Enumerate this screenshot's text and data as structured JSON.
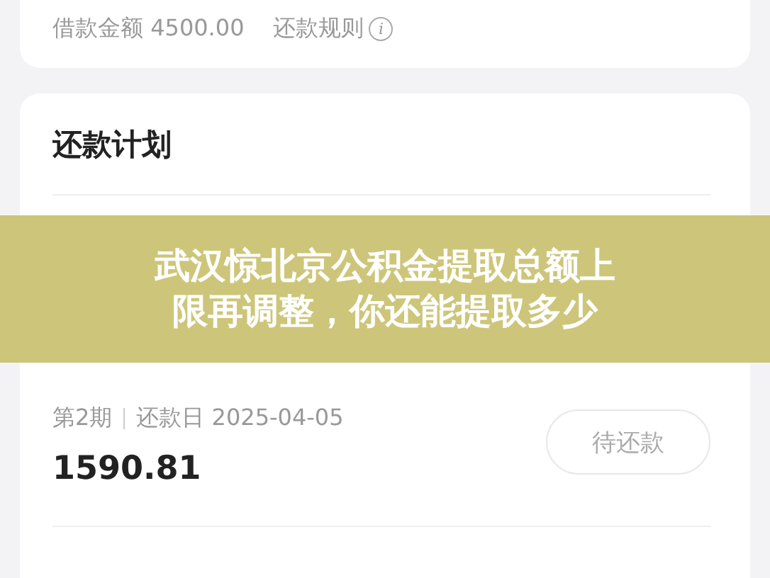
{
  "loan_summary": {
    "amount_label": "借款金额 4500.00",
    "rules_link": "还款规则",
    "info_icon": "i"
  },
  "plan": {
    "title": "还款计划",
    "rows": [
      {
        "kind": "hidden"
      },
      {
        "kind": "pending",
        "period": "第2期",
        "date": "还款日 2025-04-05",
        "amount": "1590.81",
        "action": "待还款"
      },
      {
        "kind": "hidden"
      }
    ]
  },
  "banner": {
    "lines": [
      "武汉惊北京公积金提取总额上",
      "限再调整，你还能提取多少"
    ]
  }
}
